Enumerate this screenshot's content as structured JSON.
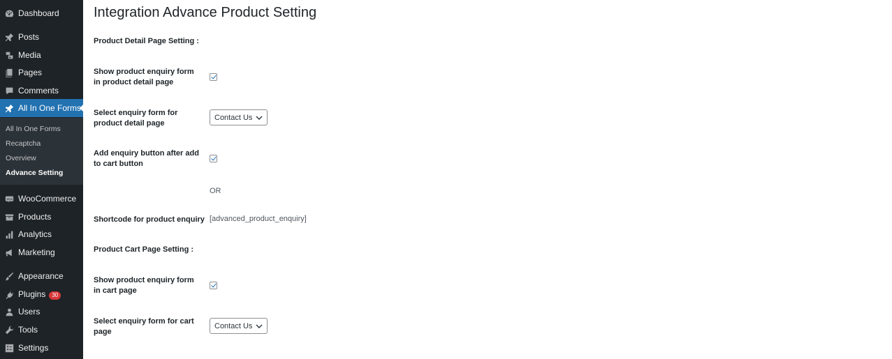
{
  "sidebar": {
    "items": [
      {
        "label": "Dashboard",
        "icon": "dashboard-icon"
      },
      {
        "label": "Posts",
        "icon": "pin-icon"
      },
      {
        "label": "Media",
        "icon": "media-icon"
      },
      {
        "label": "Pages",
        "icon": "pages-icon"
      },
      {
        "label": "Comments",
        "icon": "comments-icon"
      },
      {
        "label": "All In One Forms",
        "icon": "pin-icon",
        "current": true
      },
      {
        "label": "WooCommerce",
        "icon": "woo-icon"
      },
      {
        "label": "Products",
        "icon": "archive-icon"
      },
      {
        "label": "Analytics",
        "icon": "chart-icon"
      },
      {
        "label": "Marketing",
        "icon": "megaphone-icon"
      },
      {
        "label": "Appearance",
        "icon": "brush-icon"
      },
      {
        "label": "Plugins",
        "icon": "plugin-icon",
        "badge": "30"
      },
      {
        "label": "Users",
        "icon": "user-icon"
      },
      {
        "label": "Tools",
        "icon": "wrench-icon"
      },
      {
        "label": "Settings",
        "icon": "settings-icon"
      }
    ],
    "submenu": [
      "All In One Forms",
      "Recaptcha",
      "Overview",
      "Advance Setting"
    ],
    "active_submenu": "Advance Setting",
    "accent_color": "#2271b1",
    "background_color": "#1d2327"
  },
  "main": {
    "title": "Integration Advance Product Setting",
    "detail_section": {
      "heading": "Product Detail Page Setting :",
      "show_form_label": "Show product enquiry form in product detail page",
      "show_form_checked": true,
      "select_form_label": "Select enquiry form for product detail page",
      "select_form_value": "Contact Us",
      "add_button_label": "Add enquiry button after add to cart button",
      "add_button_checked": true,
      "or_text": "OR",
      "shortcode_label": "Shortcode for product enquiry",
      "shortcode_value": "[advanced_product_enquiry]"
    },
    "cart_section": {
      "heading": "Product Cart Page Setting :",
      "show_form_label": "Show product enquiry form in cart page",
      "show_form_checked": true,
      "select_form_label": "Select enquiry form for cart page",
      "select_form_value": "Contact Us"
    }
  }
}
